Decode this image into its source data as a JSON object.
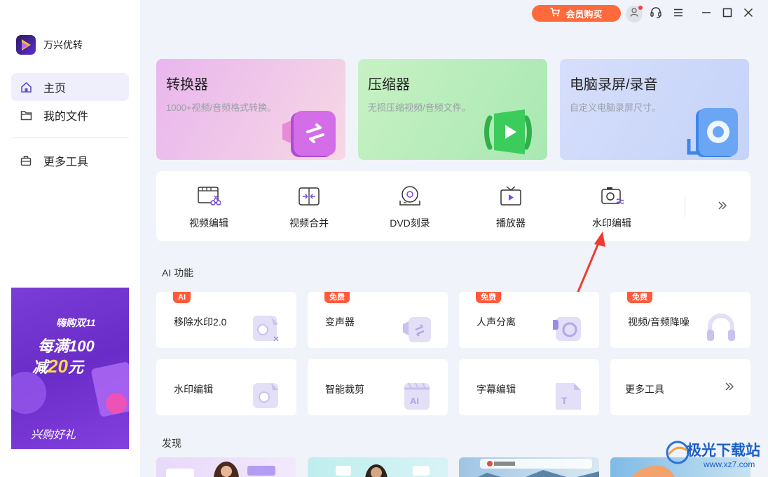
{
  "app": {
    "name": "万兴优转"
  },
  "sidebar": {
    "items": [
      {
        "label": "主页",
        "icon": "home-icon",
        "active": true
      },
      {
        "label": "我的文件",
        "icon": "folder-icon",
        "active": false
      },
      {
        "label": "更多工具",
        "icon": "toolbox-icon",
        "active": false
      }
    ]
  },
  "promo": {
    "line1": "嗨购双11",
    "line2": "每满100",
    "line3_prefix": "减",
    "line3_amount": "20",
    "line3_suffix": "元",
    "line4": "兴购好礼"
  },
  "topbar": {
    "buy_label": "会员购买"
  },
  "big_cards": [
    {
      "title": "转换器",
      "subtitle": "1000+视频/音频格式转换。",
      "icon": "converter-icon",
      "color_start": "#e9b6ee",
      "color_end": "#f4d3e6"
    },
    {
      "title": "压缩器",
      "subtitle": "无损压缩视频/音频文件。",
      "icon": "compressor-icon",
      "color_start": "#b9ecc0",
      "color_end": "#d8f4d8"
    },
    {
      "title": "电脑录屏/录音",
      "subtitle": "自定义电脑录屏尺寸。",
      "icon": "screen-recorder-icon",
      "color_start": "#c6d3f8",
      "color_end": "#dde5fb"
    }
  ],
  "tools": [
    {
      "label": "视频编辑",
      "icon": "video-edit-icon"
    },
    {
      "label": "视频合并",
      "icon": "video-merge-icon"
    },
    {
      "label": "DVD刻录",
      "icon": "dvd-burn-icon"
    },
    {
      "label": "播放器",
      "icon": "player-icon"
    },
    {
      "label": "水印编辑",
      "icon": "watermark-edit-icon"
    }
  ],
  "sections": {
    "ai": "AI 功能",
    "discover": "发现"
  },
  "ai_cards": [
    {
      "label": "移除水印2.0",
      "badge": "AI",
      "badge_color": "#ff5a3c",
      "icon": "remove-watermark-icon"
    },
    {
      "label": "变声器",
      "badge": "免费",
      "badge_color": "#ff5a3c",
      "icon": "voice-changer-icon"
    },
    {
      "label": "人声分离",
      "badge": "免费",
      "badge_color": "#ff5a3c",
      "icon": "vocal-separation-icon"
    },
    {
      "label": "视频/音频降噪",
      "badge": "免费",
      "badge_color": "#ff5a3c",
      "icon": "noise-reduction-icon"
    },
    {
      "label": "水印编辑",
      "badge": "",
      "icon": "watermark-edit-icon"
    },
    {
      "label": "智能裁剪",
      "badge": "",
      "icon": "smart-crop-icon"
    },
    {
      "label": "字幕编辑",
      "badge": "",
      "icon": "subtitle-edit-icon"
    },
    {
      "label": "更多工具",
      "badge": "",
      "icon": "chevrons-right-icon"
    }
  ],
  "watermark": {
    "title": "极光下载站",
    "url": "www.xz7.com"
  }
}
